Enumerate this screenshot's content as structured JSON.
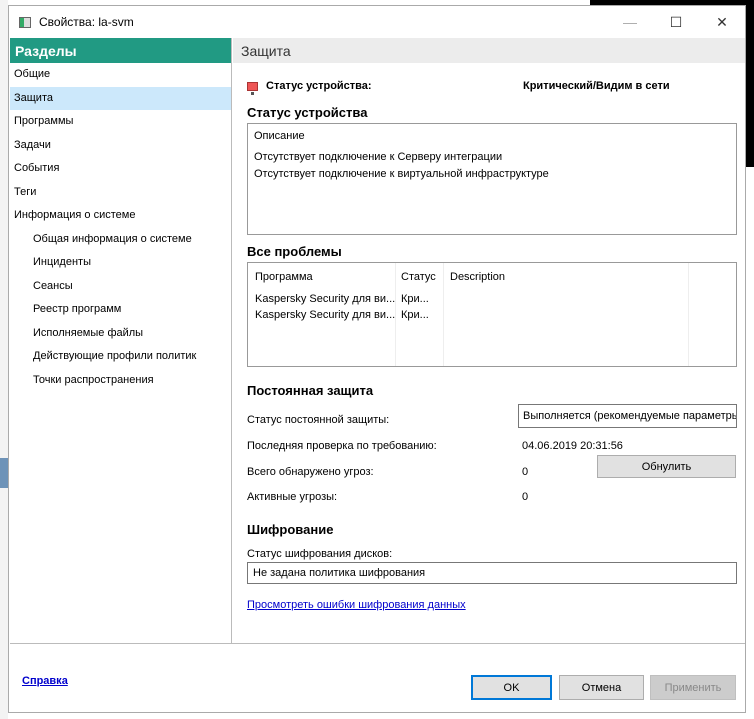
{
  "window": {
    "title": "Свойства: la-svm",
    "minimize": "—",
    "maximize": "☐",
    "close": "✕"
  },
  "sidebar": {
    "header": "Разделы",
    "items": [
      {
        "label": "Общие"
      },
      {
        "label": "Защита"
      },
      {
        "label": "Программы"
      },
      {
        "label": "Задачи"
      },
      {
        "label": "События"
      },
      {
        "label": "Теги"
      },
      {
        "label": "Информация о системе"
      },
      {
        "label": "Общая информация о системе"
      },
      {
        "label": "Инциденты"
      },
      {
        "label": "Сеансы"
      },
      {
        "label": "Реестр программ"
      },
      {
        "label": "Исполняемые файлы"
      },
      {
        "label": "Действующие профили политик"
      },
      {
        "label": "Точки распространения"
      }
    ]
  },
  "main": {
    "header": "Защита",
    "device_status_label": "Статус устройства:",
    "device_status_value": "Критический/Видим в сети",
    "status_color": "#e55555",
    "status_section": "Статус устройства",
    "status_box": {
      "title": "Описание",
      "lines": [
        "Отсутствует подключение к Серверу интеграции",
        "Отсутствует подключение к виртуальной инфраструктуре"
      ]
    },
    "problems_section": "Все проблемы",
    "problems": {
      "columns": [
        "Программа",
        "Статус",
        "Description"
      ],
      "rows": [
        [
          "Kaspersky Security для ви...",
          "Кри...",
          ""
        ],
        [
          "Kaspersky Security для ви...",
          "Кри...",
          ""
        ]
      ]
    },
    "rtp_section": "Постоянная защита",
    "rtp_status_label": "Статус постоянной защиты:",
    "rtp_status_value": "Выполняется (рекомендуемые параметры)",
    "last_scan_label": "Последняя проверка по требованию:",
    "last_scan_value": "04.06.2019 20:31:56",
    "threats_label": "Всего обнаружено угроз:",
    "threats_value": "0",
    "reset_button": "Обнулить",
    "active_label": "Активные угрозы:",
    "active_value": "0",
    "enc_section": "Шифрование",
    "enc_label": "Статус шифрования дисков:",
    "enc_value": "Не задана политика шифрования",
    "enc_link": "Просмотреть ошибки шифрования данных"
  },
  "footer": {
    "help": "Справка",
    "ok": "OK",
    "cancel": "Отмена",
    "apply": "Применить"
  }
}
